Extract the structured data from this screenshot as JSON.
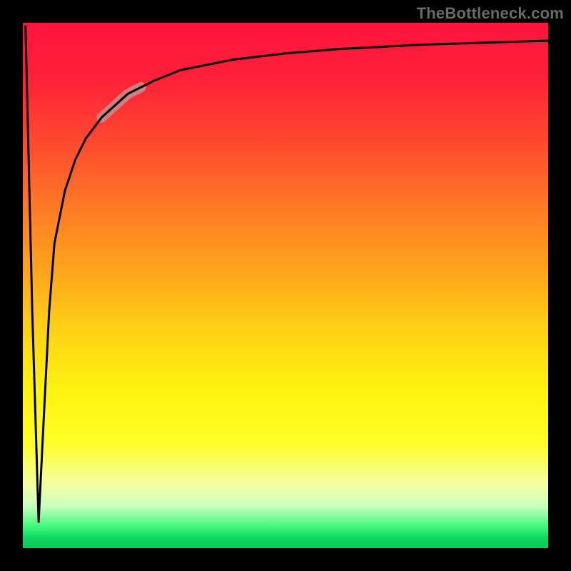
{
  "watermark": "TheBottleneck.com",
  "chart_data": {
    "type": "line",
    "title": "",
    "xlabel": "",
    "ylabel": "",
    "xlim": [
      0,
      100
    ],
    "ylim": [
      0,
      100
    ],
    "grid": false,
    "legend": false,
    "series": [
      {
        "name": "curve",
        "color": "#000000",
        "x": [
          0.5,
          1.8,
          3.0,
          4.0,
          5.0,
          6.0,
          8.0,
          10.0,
          12.0,
          15.0,
          20.0,
          25.0,
          30.0,
          40.0,
          50.0,
          60.0,
          75.0,
          90.0,
          100.0
        ],
        "y": [
          99.5,
          45.0,
          5.0,
          25.0,
          45.0,
          58.0,
          68.0,
          74.0,
          78.0,
          82.0,
          86.5,
          89.0,
          91.0,
          93.0,
          94.2,
          95.0,
          95.8,
          96.3,
          96.6
        ]
      }
    ],
    "highlight": {
      "name": "highlight-band",
      "color": "#c78a8a",
      "x_range": [
        15.0,
        22.5
      ],
      "thickness_px": 14
    }
  }
}
